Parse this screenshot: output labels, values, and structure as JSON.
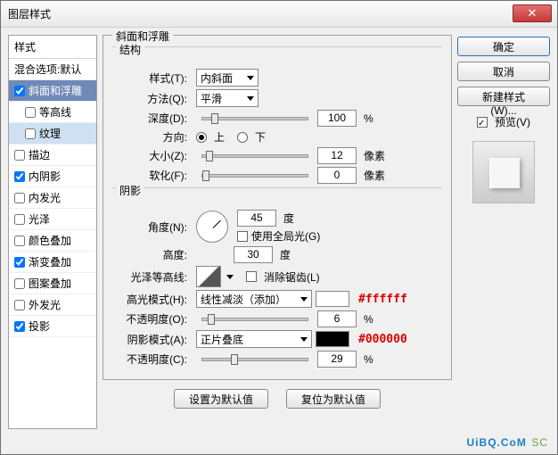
{
  "window": {
    "title": "图层样式"
  },
  "sidebar": {
    "header": "样式",
    "blend": "混合选项:默认",
    "items": {
      "bevel": {
        "label": "斜面和浮雕",
        "checked": true
      },
      "contour": {
        "label": "等高线",
        "checked": false
      },
      "texture": {
        "label": "纹理",
        "checked": false
      },
      "stroke": {
        "label": "描边",
        "checked": false
      },
      "innerShadow": {
        "label": "内阴影",
        "checked": true
      },
      "innerGlow": {
        "label": "内发光",
        "checked": false
      },
      "satin": {
        "label": "光泽",
        "checked": false
      },
      "colorOverlay": {
        "label": "颜色叠加",
        "checked": false
      },
      "gradOverlay": {
        "label": "渐变叠加",
        "checked": true
      },
      "patOverlay": {
        "label": "图案叠加",
        "checked": false
      },
      "outerGlow": {
        "label": "外发光",
        "checked": false
      },
      "dropShadow": {
        "label": "投影",
        "checked": true
      }
    }
  },
  "panel": {
    "title": "斜面和浮雕",
    "structure": {
      "legend": "结构",
      "styleLabel": "样式(T):",
      "styleValue": "内斜面",
      "methodLabel": "方法(Q):",
      "methodValue": "平滑",
      "depthLabel": "深度(D):",
      "depthValue": "100",
      "depthUnit": "%",
      "dirLabel": "方向:",
      "dirUp": "上",
      "dirDown": "下",
      "sizeLabel": "大小(Z):",
      "sizeValue": "12",
      "sizeUnit": "像素",
      "softenLabel": "软化(F):",
      "softenValue": "0",
      "softenUnit": "像素"
    },
    "shading": {
      "legend": "阴影",
      "angleLabel": "角度(N):",
      "angleValue": "45",
      "angleUnit": "度",
      "globalLabel": "使用全局光(G)",
      "altLabel": "高度:",
      "altValue": "30",
      "altUnit": "度",
      "glossLabel": "光泽等高线:",
      "aaLabel": "消除锯齿(L)",
      "hiModeLabel": "高光模式(H):",
      "hiModeValue": "线性减淡（添加）",
      "hiColor": "#ffffff",
      "hiHex": "#ffffff",
      "hiOpLabel": "不透明度(O):",
      "hiOpValue": "6",
      "hiOpUnit": "%",
      "shModeLabel": "阴影模式(A):",
      "shModeValue": "正片叠底",
      "shColor": "#000000",
      "shHex": "#000000",
      "shOpLabel": "不透明度(C):",
      "shOpValue": "29",
      "shOpUnit": "%"
    },
    "buttons": {
      "setDefault": "设置为默认值",
      "resetDefault": "复位为默认值"
    }
  },
  "right": {
    "ok": "确定",
    "cancel": "取消",
    "newStyle": "新建样式(W)...",
    "previewLabel": "预览(V)"
  },
  "footer": {
    "brand": "UiBQ.CoM",
    "tag": "SC"
  }
}
